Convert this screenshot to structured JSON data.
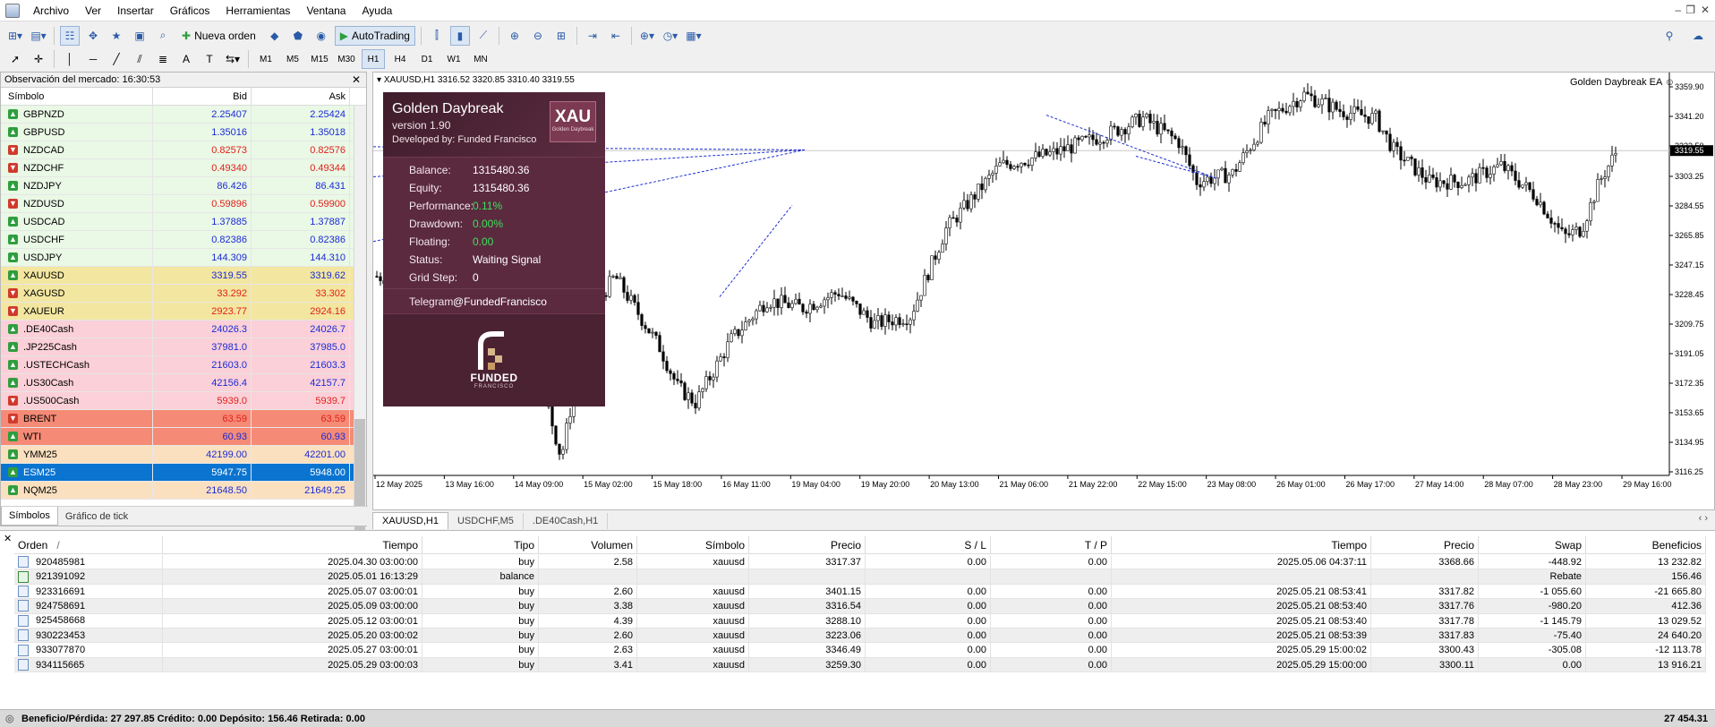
{
  "menu": {
    "items": [
      "Archivo",
      "Ver",
      "Insertar",
      "Gráficos",
      "Herramientas",
      "Ventana",
      "Ayuda"
    ]
  },
  "toolbar": {
    "new_order": "Nueva orden",
    "autotrading": "AutoTrading",
    "timeframes": [
      "M1",
      "M5",
      "M15",
      "M30",
      "H1",
      "H4",
      "D1",
      "W1",
      "MN"
    ],
    "active_timeframe": "H1"
  },
  "market_watch": {
    "title": "Observación del mercado: 16:30:53",
    "col_symbol": "Símbolo",
    "col_bid": "Bid",
    "col_ask": "Ask",
    "rows": [
      {
        "symbol": "GBPNZD",
        "bid": "2.25407",
        "ask": "2.25424",
        "dir": "up",
        "bg": "#eaf8e6",
        "color": "#1a2bd6"
      },
      {
        "symbol": "GBPUSD",
        "bid": "1.35016",
        "ask": "1.35018",
        "dir": "up",
        "bg": "#eaf8e6",
        "color": "#1a2bd6"
      },
      {
        "symbol": "NZDCAD",
        "bid": "0.82573",
        "ask": "0.82576",
        "dir": "dn",
        "bg": "#eaf8e6",
        "color": "#e0201a"
      },
      {
        "symbol": "NZDCHF",
        "bid": "0.49340",
        "ask": "0.49344",
        "dir": "dn",
        "bg": "#eaf8e6",
        "color": "#e0201a"
      },
      {
        "symbol": "NZDJPY",
        "bid": "86.426",
        "ask": "86.431",
        "dir": "up",
        "bg": "#eaf8e6",
        "color": "#1a2bd6"
      },
      {
        "symbol": "NZDUSD",
        "bid": "0.59896",
        "ask": "0.59900",
        "dir": "dn",
        "bg": "#eaf8e6",
        "color": "#e0201a"
      },
      {
        "symbol": "USDCAD",
        "bid": "1.37885",
        "ask": "1.37887",
        "dir": "up",
        "bg": "#eaf8e6",
        "color": "#1a2bd6"
      },
      {
        "symbol": "USDCHF",
        "bid": "0.82386",
        "ask": "0.82386",
        "dir": "up",
        "bg": "#eaf8e6",
        "color": "#1a2bd6"
      },
      {
        "symbol": "USDJPY",
        "bid": "144.309",
        "ask": "144.310",
        "dir": "up",
        "bg": "#eaf8e6",
        "color": "#1a2bd6"
      },
      {
        "symbol": "XAUUSD",
        "bid": "3319.55",
        "ask": "3319.62",
        "dir": "up",
        "bg": "#f3e6a0",
        "color": "#1a2bd6"
      },
      {
        "symbol": "XAGUSD",
        "bid": "33.292",
        "ask": "33.302",
        "dir": "dn",
        "bg": "#f3e6a0",
        "color": "#e0201a"
      },
      {
        "symbol": "XAUEUR",
        "bid": "2923.77",
        "ask": "2924.16",
        "dir": "dn",
        "bg": "#f3e6a0",
        "color": "#e0201a"
      },
      {
        "symbol": ".DE40Cash",
        "bid": "24026.3",
        "ask": "24026.7",
        "dir": "up",
        "bg": "#fbd0d8",
        "color": "#1a2bd6"
      },
      {
        "symbol": ".JP225Cash",
        "bid": "37981.0",
        "ask": "37985.0",
        "dir": "up",
        "bg": "#fbd0d8",
        "color": "#1a2bd6"
      },
      {
        "symbol": ".USTECHCash",
        "bid": "21603.0",
        "ask": "21603.3",
        "dir": "up",
        "bg": "#fbd0d8",
        "color": "#1a2bd6"
      },
      {
        "symbol": ".US30Cash",
        "bid": "42156.4",
        "ask": "42157.7",
        "dir": "up",
        "bg": "#fbd0d8",
        "color": "#1a2bd6"
      },
      {
        "symbol": ".US500Cash",
        "bid": "5939.0",
        "ask": "5939.7",
        "dir": "dn",
        "bg": "#fbd0d8",
        "color": "#e0201a"
      },
      {
        "symbol": "BRENT",
        "bid": "63.59",
        "ask": "63.59",
        "dir": "dn",
        "bg": "#f58a76",
        "color": "#e0201a"
      },
      {
        "symbol": "WTI",
        "bid": "60.93",
        "ask": "60.93",
        "dir": "up",
        "bg": "#f58a76",
        "color": "#1a2bd6"
      },
      {
        "symbol": "YMM25",
        "bid": "42199.00",
        "ask": "42201.00",
        "dir": "up",
        "bg": "#fbe0c0",
        "color": "#1a2bd6"
      },
      {
        "symbol": "ESM25",
        "bid": "5947.75",
        "ask": "5948.00",
        "dir": "up",
        "bg": "#0a74d0",
        "color": "#ffffff"
      },
      {
        "symbol": "NQM25",
        "bid": "21648.50",
        "ask": "21649.25",
        "dir": "up",
        "bg": "#fbe0c0",
        "color": "#1a2bd6"
      }
    ],
    "tabs": [
      "Símbolos",
      "Gráfico de tick"
    ]
  },
  "chart": {
    "header": "XAUUSD,H1  3316.52 3320.85 3310.40 3319.55",
    "ea_label": "Golden Daybreak EA ☺",
    "price_ticks": [
      "3359.90",
      "3341.20",
      "3322.50",
      "3303.25",
      "3284.55",
      "3265.85",
      "3247.15",
      "3228.45",
      "3209.75",
      "3191.05",
      "3172.35",
      "3153.65",
      "3134.95",
      "3116.25"
    ],
    "current_price": "3319.55",
    "time_ticks": [
      "12 May 2025",
      "13 May 16:00",
      "14 May 09:00",
      "15 May 02:00",
      "15 May 18:00",
      "16 May 11:00",
      "19 May 04:00",
      "19 May 20:00",
      "20 May 13:00",
      "21 May 06:00",
      "21 May 22:00",
      "22 May 15:00",
      "23 May 08:00",
      "26 May 01:00",
      "26 May 17:00",
      "27 May 14:00",
      "28 May 07:00",
      "28 May 23:00",
      "29 May 16:00"
    ],
    "tabs": [
      "XAUUSD,H1",
      "USDCHF,M5",
      ".DE40Cash,H1"
    ]
  },
  "panel": {
    "title": "Golden Daybreak",
    "version": "version 1.90",
    "developer": "Developed by: Funded Francisco",
    "logo_text": "XAU",
    "logo_sub": "Golden Daybreak",
    "stats": [
      {
        "label": "Balance:",
        "value": "1315480.36",
        "green": false
      },
      {
        "label": "Equity:",
        "value": "1315480.36",
        "green": false
      },
      {
        "label": "Performance:",
        "value": "0.11%",
        "green": true
      },
      {
        "label": "Drawdown:",
        "value": "0.00%",
        "green": true
      },
      {
        "label": "Floating:",
        "value": "0.00",
        "green": true
      },
      {
        "label": "Status:",
        "value": "Waiting Signal",
        "green": false
      },
      {
        "label": "Grid Step:",
        "value": "0",
        "green": false
      }
    ],
    "telegram_label": "Telegram:",
    "telegram_value": "@FundedFrancisco",
    "brand": "FUNDED",
    "brand_sub": "FRANCISCO"
  },
  "terminal": {
    "columns": [
      "Orden",
      "Tiempo",
      "Tipo",
      "Volumen",
      "Símbolo",
      "Precio",
      "S / L",
      "T / P",
      "Tiempo",
      "Precio",
      "Swap",
      "Beneficios"
    ],
    "sort_mark": "/",
    "rows": [
      {
        "order": "920485981",
        "time": "2025.04.30 03:00:00",
        "type": "buy",
        "vol": "2.58",
        "sym": "xauusd",
        "price": "3317.37",
        "sl": "0.00",
        "tp": "0.00",
        "ctime": "2025.05.06 04:37:11",
        "cprice": "3368.66",
        "swap": "-448.92",
        "profit": "13 232.82",
        "kind": "trade"
      },
      {
        "order": "921391092",
        "time": "2025.05.01 16:13:29",
        "type": "balance",
        "vol": "",
        "sym": "",
        "price": "",
        "sl": "",
        "tp": "",
        "ctime": "",
        "cprice": "",
        "swap": "Rebate",
        "profit": "156.46",
        "kind": "balance"
      },
      {
        "order": "923316691",
        "time": "2025.05.07 03:00:01",
        "type": "buy",
        "vol": "2.60",
        "sym": "xauusd",
        "price": "3401.15",
        "sl": "0.00",
        "tp": "0.00",
        "ctime": "2025.05.21 08:53:41",
        "cprice": "3317.82",
        "swap": "-1 055.60",
        "profit": "-21 665.80",
        "kind": "trade"
      },
      {
        "order": "924758691",
        "time": "2025.05.09 03:00:00",
        "type": "buy",
        "vol": "3.38",
        "sym": "xauusd",
        "price": "3316.54",
        "sl": "0.00",
        "tp": "0.00",
        "ctime": "2025.05.21 08:53:40",
        "cprice": "3317.76",
        "swap": "-980.20",
        "profit": "412.36",
        "kind": "trade"
      },
      {
        "order": "925458668",
        "time": "2025.05.12 03:00:01",
        "type": "buy",
        "vol": "4.39",
        "sym": "xauusd",
        "price": "3288.10",
        "sl": "0.00",
        "tp": "0.00",
        "ctime": "2025.05.21 08:53:40",
        "cprice": "3317.78",
        "swap": "-1 145.79",
        "profit": "13 029.52",
        "kind": "trade"
      },
      {
        "order": "930223453",
        "time": "2025.05.20 03:00:02",
        "type": "buy",
        "vol": "2.60",
        "sym": "xauusd",
        "price": "3223.06",
        "sl": "0.00",
        "tp": "0.00",
        "ctime": "2025.05.21 08:53:39",
        "cprice": "3317.83",
        "swap": "-75.40",
        "profit": "24 640.20",
        "kind": "trade"
      },
      {
        "order": "933077870",
        "time": "2025.05.27 03:00:01",
        "type": "buy",
        "vol": "2.63",
        "sym": "xauusd",
        "price": "3346.49",
        "sl": "0.00",
        "tp": "0.00",
        "ctime": "2025.05.29 15:00:02",
        "cprice": "3300.43",
        "swap": "-305.08",
        "profit": "-12 113.78",
        "kind": "trade"
      },
      {
        "order": "934115665",
        "time": "2025.05.29 03:00:03",
        "type": "buy",
        "vol": "3.41",
        "sym": "xauusd",
        "price": "3259.30",
        "sl": "0.00",
        "tp": "0.00",
        "ctime": "2025.05.29 15:00:00",
        "cprice": "3300.11",
        "swap": "0.00",
        "profit": "13 916.21",
        "kind": "trade"
      }
    ],
    "summary": "Beneficio/Pérdida: 27 297.85  Crédito: 0.00  Depósito: 156.46  Retirada: 0.00",
    "total": "27 454.31"
  },
  "colors": {
    "bull": "#000000",
    "bear": "#000000",
    "grid_line": "#c8c8c8",
    "trend_line": "#1f2fd0",
    "accent_panel": "#4a2232"
  }
}
